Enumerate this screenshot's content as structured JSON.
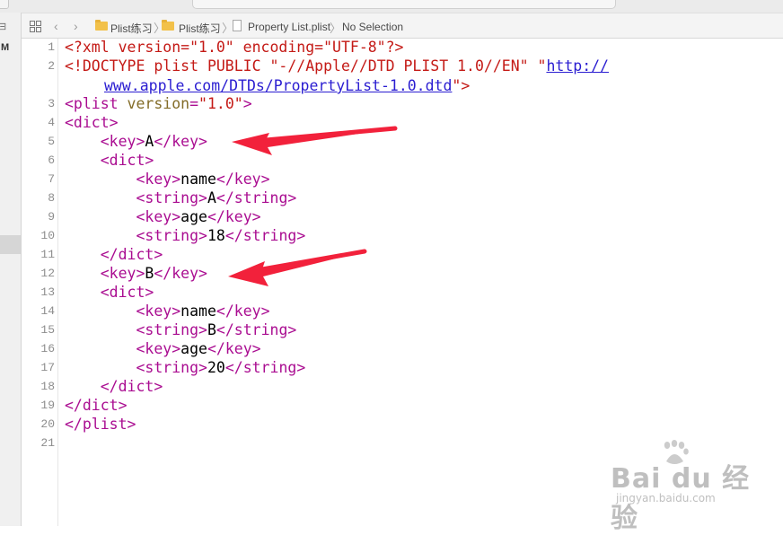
{
  "jumpbar": {
    "crumbs": [
      "Plist练习",
      "Plist练习",
      "Property List.plist",
      "No Selection"
    ],
    "separator": "〉"
  },
  "left_nav": {
    "label_top": "⊟",
    "label_m": "M"
  },
  "line_numbers": [
    "1",
    "2",
    "3",
    "4",
    "5",
    "6",
    "7",
    "8",
    "9",
    "10",
    "11",
    "12",
    "13",
    "14",
    "15",
    "16",
    "17",
    "18",
    "19",
    "20",
    "21"
  ],
  "code": {
    "l1_a": "<?xml version=\"1.0\" encoding=\"UTF-8\"?>",
    "l2_a": "<!DOCTYPE plist PUBLIC ",
    "l2_b": "\"-//Apple//DTD PLIST 1.0//EN\"",
    "l2_c": " \"",
    "l2_d": "http://",
    "l2w_a": "www.apple.com/DTDs/PropertyList-1.0.dtd",
    "l2w_b": "\">",
    "l3_a": "<plist ",
    "l3_b": "version",
    "l3_c": "=",
    "l3_d": "\"1.0\"",
    "l3_e": ">",
    "dict_open": "<dict>",
    "dict_close": "</dict>",
    "plist_close": "</plist>",
    "key_open": "<key>",
    "key_close": "</key>",
    "string_open": "<string>",
    "string_close": "</string>",
    "k_A": "A",
    "k_B": "B",
    "k_name": "name",
    "k_age": "age",
    "v_A": "A",
    "v_18": "18",
    "v_B": "B",
    "v_20": "20"
  },
  "watermark": {
    "brand": "Bai du 经验",
    "url": "jingyan.baidu.com"
  },
  "colors": {
    "tag": "#aa0d91",
    "string": "#c41a16",
    "link": "#2a1dd1",
    "arrow": "#f2213b"
  }
}
